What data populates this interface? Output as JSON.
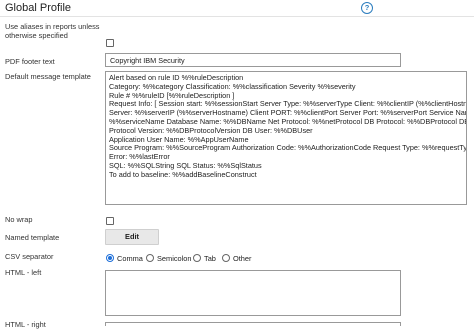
{
  "page": {
    "title": "Global Profile",
    "help_symbol": "?"
  },
  "fields": {
    "use_aliases": {
      "label": "Use aliases in reports unless otherwise specified",
      "checked": false
    },
    "pdf_footer": {
      "label": "PDF footer text",
      "value": "Copyright IBM Security"
    },
    "default_message_template": {
      "label": "Default message template",
      "lines": [
        "Alert based on rule ID %%ruleDescription",
        "Category: %%category  Classification: %%classification   Severity %%severity",
        "Rule # %%ruleID [%%ruleDescription ]",
        "Request Info: [ Session start: %%sessionStart Server Type: %%serverType Client: %%clientIP (%%clientHostname)",
        "Server: %%serverIP (%%serverHostname) Client PORT: %%clientPort Server Port: %%serverPort Service Name:",
        "%%serviceName Database Name: %%DBName Net Protocol: %%netProtocol DB Protocol: %%DBProtocol DB",
        "Protocol Version: %%DBProtocolVersion DB User: %%DBUser",
        "Application User Name: %%AppUserName",
        "Source Program: %%SourceProgram Authorization Code: %%AuthorizationCode Request Type: %%requestType Last",
        "Error: %%lastError",
        "SQL: %%SQLString SQL Status: %%SqlStatus",
        " To add to baseline: %%addBaselineConstruct"
      ]
    },
    "no_wrap": {
      "label": "No wrap",
      "checked": false
    },
    "named_template": {
      "label": "Named template",
      "button": "Edit"
    },
    "csv_separator": {
      "label": "CSV separator",
      "options": [
        "Comma",
        "Semicolon",
        "Tab",
        "Other"
      ],
      "selected": "Comma"
    },
    "html_left": {
      "label": "HTML - left",
      "value": ""
    },
    "html_right": {
      "label": "HTML - right",
      "value": ""
    }
  }
}
